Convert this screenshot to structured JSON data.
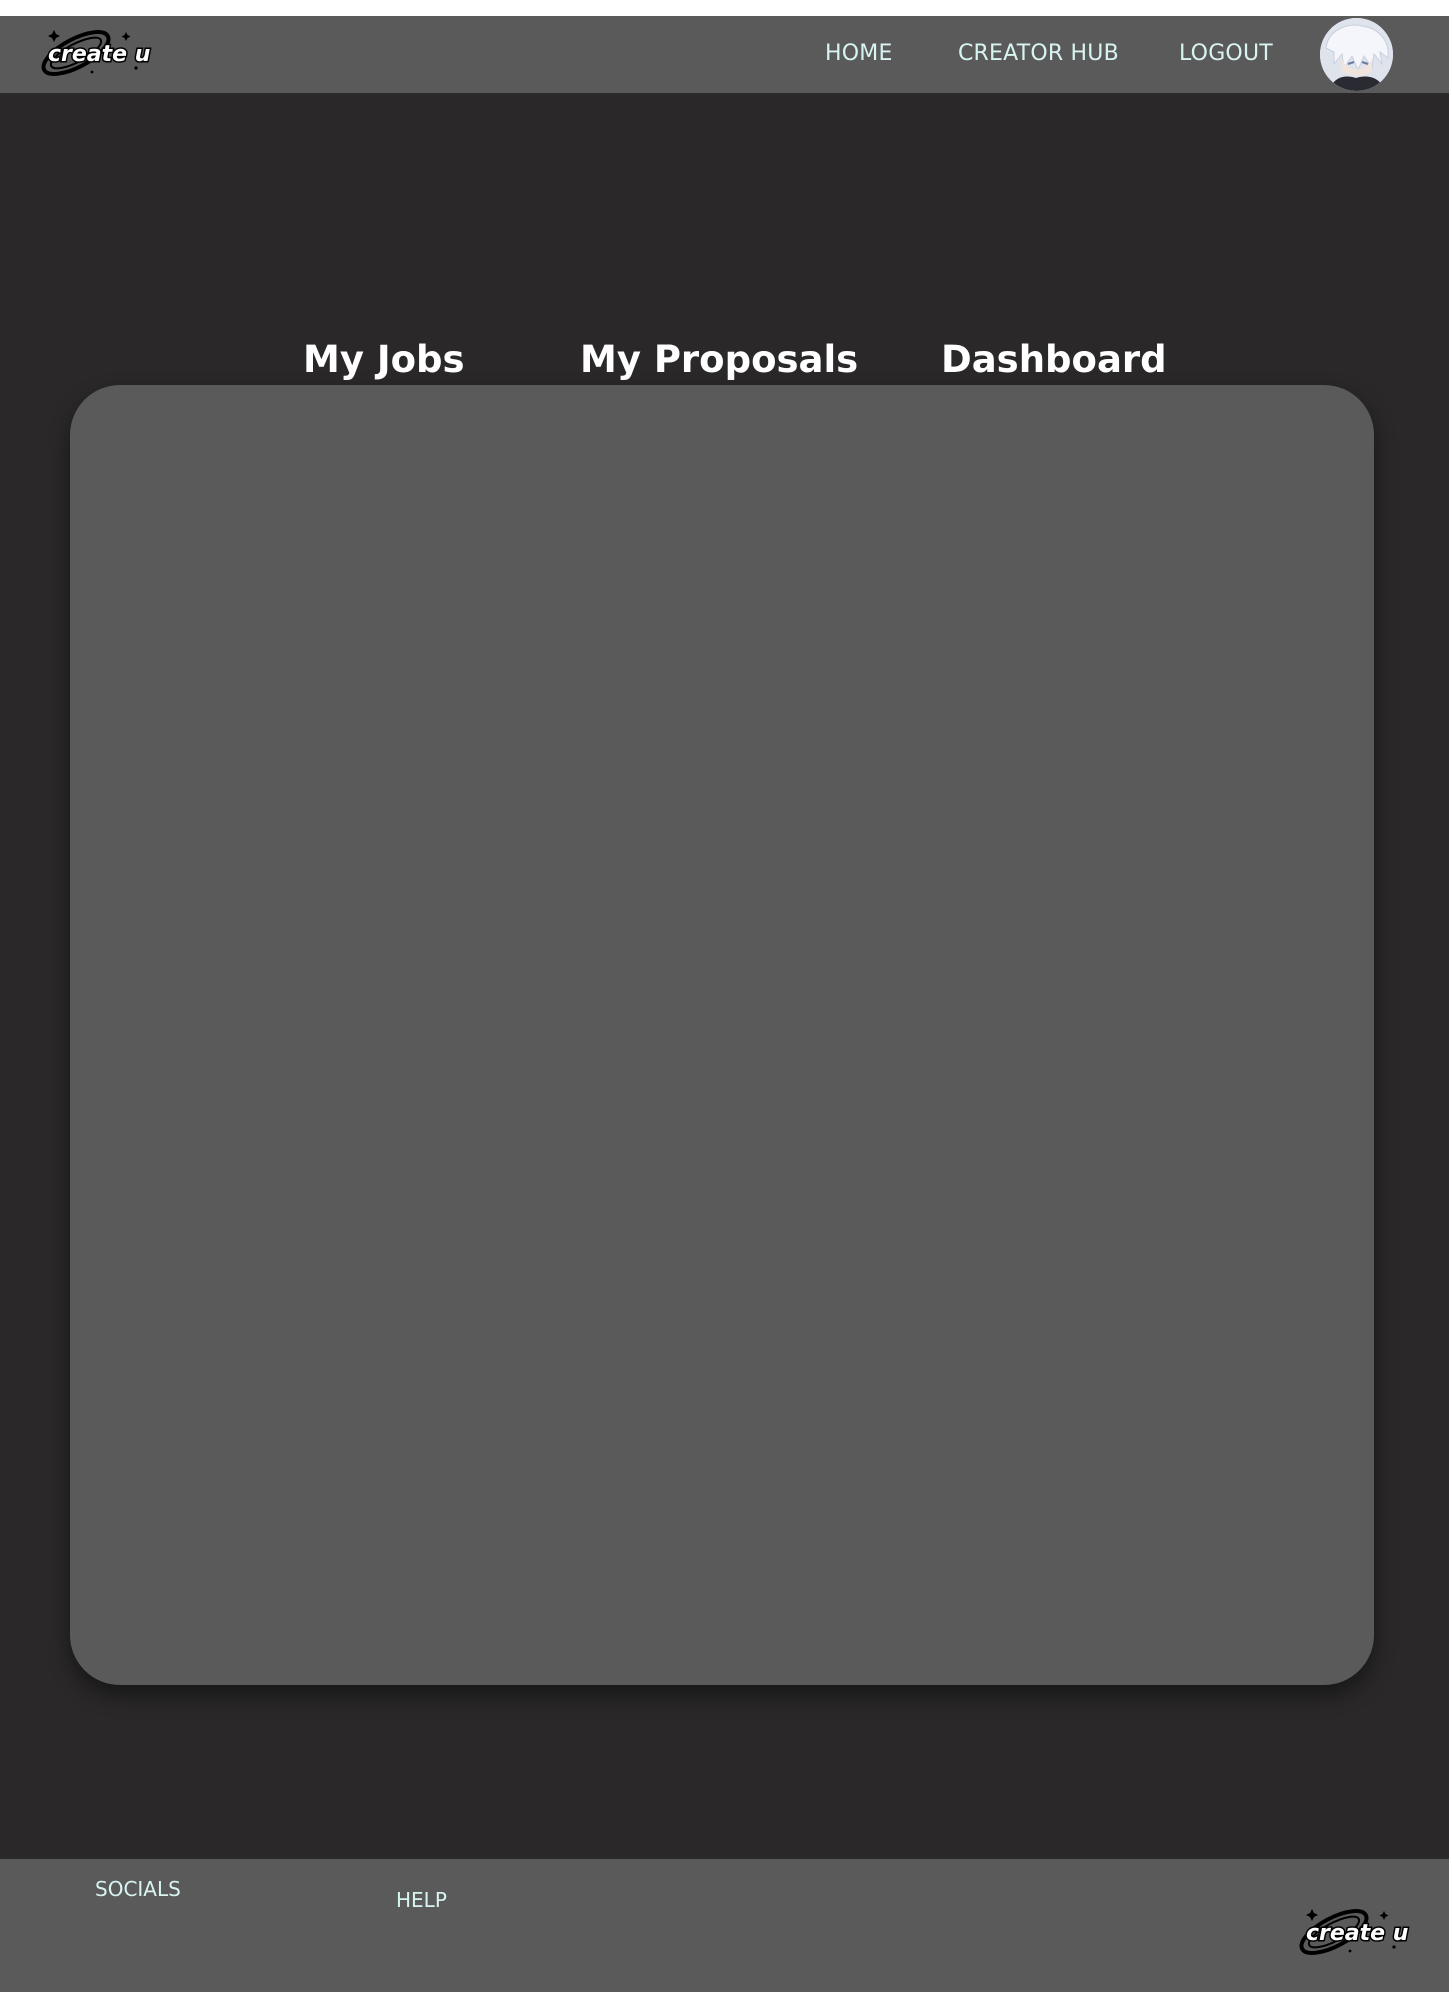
{
  "header": {
    "logo_text": "create u",
    "nav": {
      "home": "HOME",
      "creator_hub": "CREATOR HUB",
      "logout": "LOGOUT"
    }
  },
  "tabs": {
    "my_jobs": "My Jobs",
    "my_proposals": "My Proposals",
    "dashboard": "Dashboard"
  },
  "footer": {
    "socials": "SOCIALS",
    "help": "HELP",
    "logo_text": "create u"
  },
  "colors": {
    "page_background": "#2a2829",
    "bar_background": "#5b5a5b",
    "panel_background": "#5b5a5b",
    "nav_text": "#d8f4f1",
    "tab_text": "#ffffff"
  },
  "icons": {
    "logo": "create-u-logo-icon",
    "avatar": "user-avatar-icon"
  }
}
